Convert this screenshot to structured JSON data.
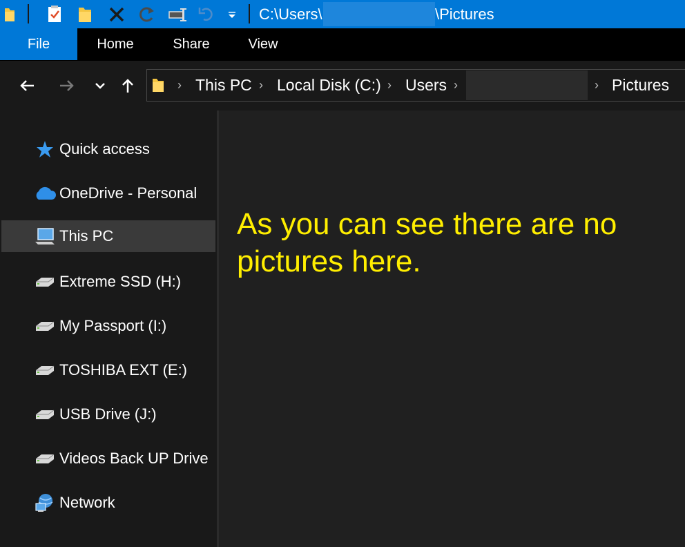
{
  "titlebar": {
    "path_prefix": "C:\\Users\\",
    "path_suffix": "\\Pictures",
    "quick_access_icons": [
      "folder-icon",
      "properties-icon",
      "new-folder-icon",
      "delete-icon",
      "redo-icon",
      "rename-icon",
      "undo-icon",
      "customize-quick-access-icon"
    ]
  },
  "ribbon": {
    "tabs": [
      {
        "label": "File",
        "active": true
      },
      {
        "label": "Home"
      },
      {
        "label": "Share"
      },
      {
        "label": "View"
      }
    ]
  },
  "address_bar": {
    "crumbs": [
      "This PC",
      "Local Disk (C:)",
      "Users",
      "Pictures"
    ]
  },
  "sidebar": {
    "items": [
      {
        "label": "Quick access",
        "icon": "star-icon"
      },
      {
        "label": "OneDrive - Personal",
        "icon": "cloud-icon"
      },
      {
        "label": "This PC",
        "icon": "computer-icon",
        "selected": true
      },
      {
        "label": "Extreme SSD (H:)",
        "icon": "drive-icon"
      },
      {
        "label": "My Passport (I:)",
        "icon": "drive-icon"
      },
      {
        "label": "TOSHIBA EXT (E:)",
        "icon": "drive-icon"
      },
      {
        "label": "USB Drive (J:)",
        "icon": "drive-icon"
      },
      {
        "label": "Videos Back UP Drive",
        "icon": "drive-icon"
      },
      {
        "label": "Network",
        "icon": "network-icon"
      }
    ]
  },
  "content": {
    "annotation_line1": "As you can see there are no",
    "annotation_line2": "pictures here."
  },
  "colors": {
    "accent": "#0078d7",
    "annotation": "#ffee00",
    "background": "#191919"
  }
}
